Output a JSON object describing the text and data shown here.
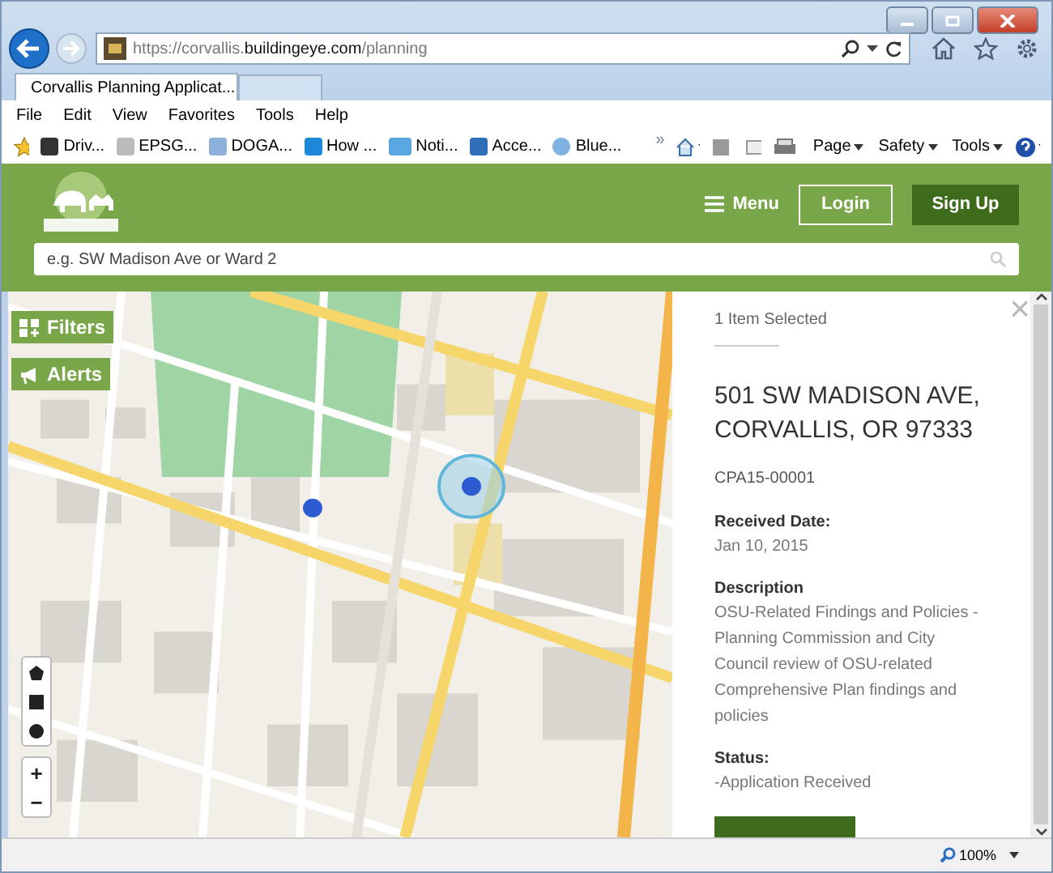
{
  "browser": {
    "url_prefix": "https://corvallis.",
    "url_domain": "buildingeye.com",
    "url_path": "/planning",
    "tabs": [
      {
        "label": "Corvallis Planning Applicat...",
        "selected": true
      }
    ],
    "menu": [
      "File",
      "Edit",
      "View",
      "Favorites",
      "Tools",
      "Help"
    ],
    "favorites": [
      "Driv...",
      "EPSG...",
      "DOGA...",
      "How ...",
      "Noti...",
      "Acce...",
      "Blue..."
    ],
    "overflow": "»",
    "commands": [
      "Page",
      "Safety",
      "Tools"
    ],
    "zoom": "100%"
  },
  "header": {
    "menu": "Menu",
    "login": "Login",
    "signup": "Sign Up",
    "search": {
      "placeholder": "e.g. SW Madison Ave or Ward 2"
    }
  },
  "map": {
    "buttons": [
      {
        "label": "Filters",
        "kind": "filters"
      },
      {
        "label": "Alerts",
        "kind": "alerts"
      }
    ],
    "zoom": [
      "+",
      "−"
    ]
  },
  "panel": {
    "close": "×",
    "selected_count": "1 Item Selected",
    "address": "501 SW MADISON AVE, CORVALLIS, OR 97333",
    "reference": "CPA15-00001",
    "fields": [
      {
        "label": "Received Date:",
        "value": "Jan 10, 2015"
      },
      {
        "label": "Description",
        "value": "OSU-Related Findings and Policies - Planning Commission and City Council review of OSU-related Comprehensive Plan findings and policies"
      },
      {
        "label": "Status:",
        "value": "-Application Received"
      }
    ]
  }
}
